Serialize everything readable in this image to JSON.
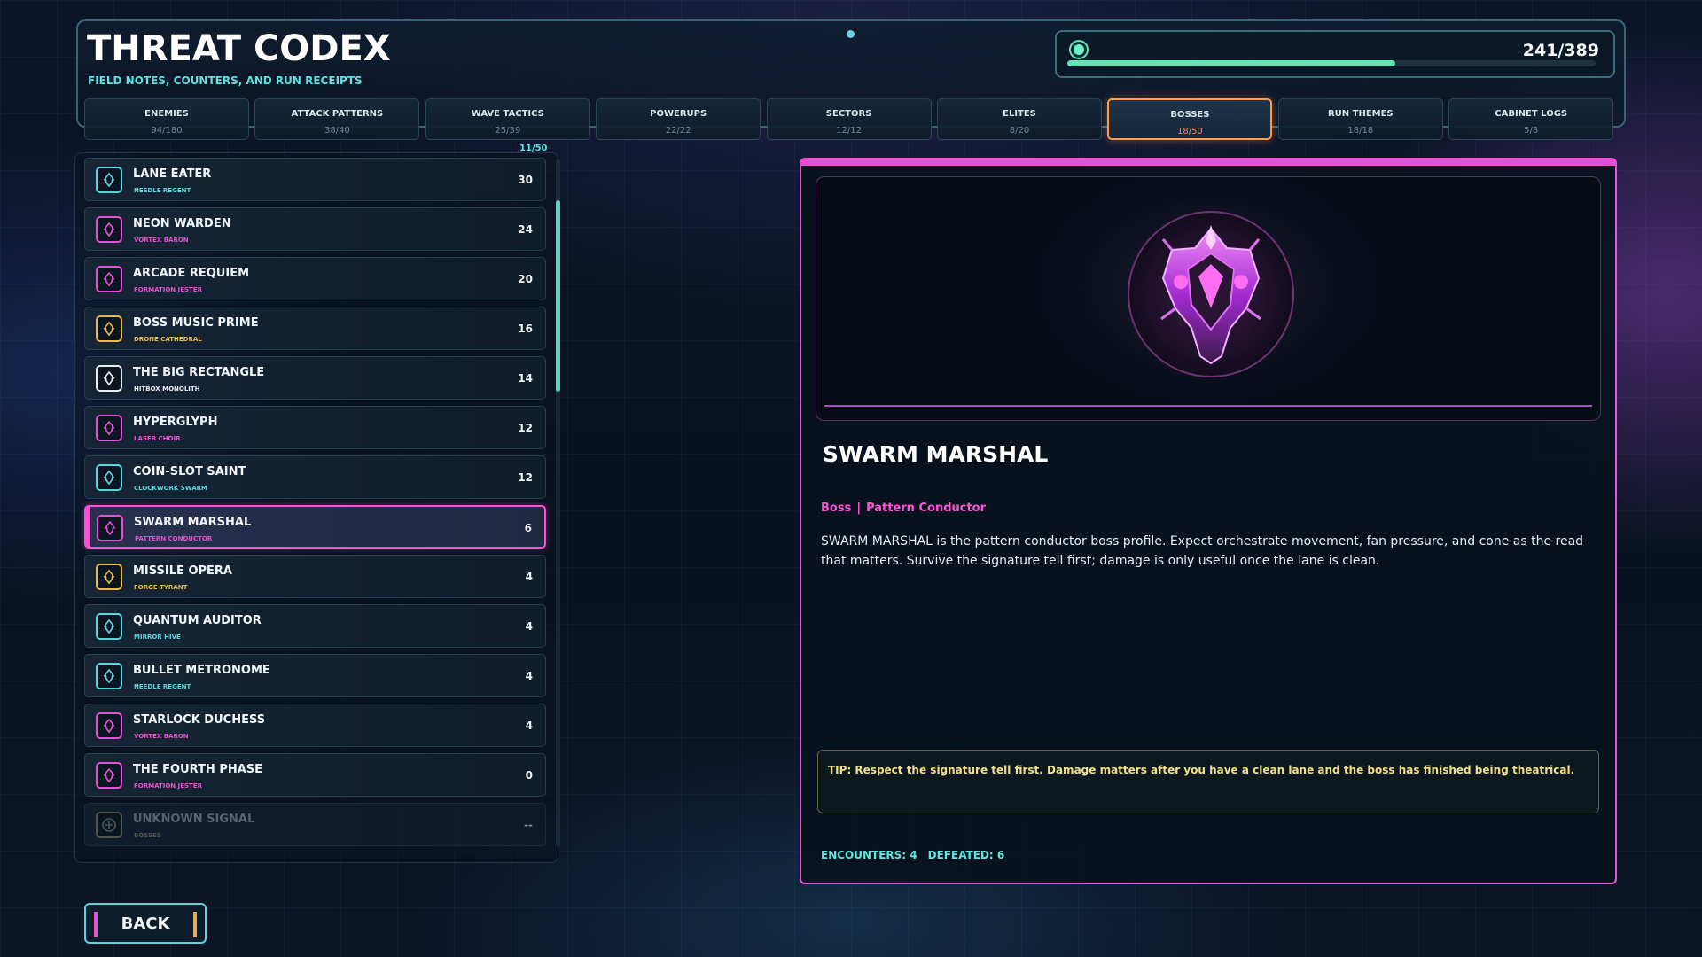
{
  "header": {
    "title": "THREAT CODEX",
    "subtitle": "FIELD NOTES, COUNTERS, AND RUN RECEIPTS",
    "progress": {
      "label": "241/389",
      "fraction": 0.62
    }
  },
  "tabs": [
    {
      "label": "ENEMIES",
      "count": "94/180"
    },
    {
      "label": "ATTACK PATTERNS",
      "count": "38/40"
    },
    {
      "label": "WAVE TACTICS",
      "count": "25/39"
    },
    {
      "label": "POWERUPS",
      "count": "22/22"
    },
    {
      "label": "SECTORS",
      "count": "12/12"
    },
    {
      "label": "ELITES",
      "count": "8/20"
    },
    {
      "label": "BOSSES",
      "count": "18/50",
      "active": true
    },
    {
      "label": "RUN THEMES",
      "count": "18/18"
    },
    {
      "label": "CABINET LOGS",
      "count": "5/8"
    }
  ],
  "list": {
    "count_label": "11/50",
    "items": [
      {
        "name": "LANE EATER",
        "sub": "NEEDLE REGENT",
        "count": "30",
        "accent": "#5cd4e0",
        "icon": "boss-sprite-icon"
      },
      {
        "name": "NEON WARDEN",
        "sub": "VORTEX BARON",
        "count": "24",
        "accent": "#e84fd4",
        "icon": "boss-sprite-icon"
      },
      {
        "name": "ARCADE REQUIEM",
        "sub": "FORMATION JESTER",
        "count": "20",
        "accent": "#e84fd4",
        "icon": "boss-sprite-icon"
      },
      {
        "name": "BOSS MUSIC PRIME",
        "sub": "DRONE CATHEDRAL",
        "count": "16",
        "accent": "#e8b84a",
        "icon": "boss-sprite-icon"
      },
      {
        "name": "THE BIG RECTANGLE",
        "sub": "HITBOX MONOLITH",
        "count": "14",
        "accent": "#e6eef2",
        "icon": "boss-sprite-icon"
      },
      {
        "name": "HYPERGLYPH",
        "sub": "LASER CHOIR",
        "count": "12",
        "accent": "#e84fd4",
        "icon": "boss-sprite-icon"
      },
      {
        "name": "COIN-SLOT SAINT",
        "sub": "CLOCKWORK SWARM",
        "count": "12",
        "accent": "#5cd4e0",
        "icon": "boss-sprite-icon"
      },
      {
        "name": "SWARM MARSHAL",
        "sub": "PATTERN CONDUCTOR",
        "count": "6",
        "accent": "#e84fd4",
        "icon": "boss-sprite-icon",
        "selected": true
      },
      {
        "name": "MISSILE OPERA",
        "sub": "FORGE TYRANT",
        "count": "4",
        "accent": "#e8b84a",
        "icon": "boss-sprite-icon"
      },
      {
        "name": "QUANTUM AUDITOR",
        "sub": "MIRROR HIVE",
        "count": "4",
        "accent": "#5cd4e0",
        "icon": "boss-sprite-icon"
      },
      {
        "name": "BULLET METRONOME",
        "sub": "NEEDLE REGENT",
        "count": "4",
        "accent": "#5cd4e0",
        "icon": "boss-sprite-icon"
      },
      {
        "name": "STARLOCK DUCHESS",
        "sub": "VORTEX BARON",
        "count": "4",
        "accent": "#e84fd4",
        "icon": "boss-sprite-icon"
      },
      {
        "name": "THE FOURTH PHASE",
        "sub": "FORMATION JESTER",
        "count": "0",
        "accent": "#e84fd4",
        "icon": "boss-sprite-icon"
      },
      {
        "name": "UNKNOWN SIGNAL",
        "sub": "BOSSES",
        "count": "--",
        "accent": "#8a8a70",
        "icon": "locked-sigil-icon",
        "locked": true
      }
    ]
  },
  "detail": {
    "name": "SWARM MARSHAL",
    "tag_type": "Boss",
    "tag_separator": "|",
    "tag_role": "Pattern Conductor",
    "description": "SWARM MARSHAL is the pattern conductor boss profile. Expect orchestrate movement, fan pressure, and cone as the read that matters. Survive the signature tell first; damage is only useful once the lane is clean.",
    "tip": "TIP: Respect the signature tell first. Damage matters after you have a clean lane and the boss has finished being theatrical.",
    "encounters_label": "ENCOUNTERS: 4",
    "defeated_label": "DEFEATED: 6"
  },
  "back_button": {
    "label": "BACK"
  },
  "colors": {
    "accent_cyan": "#5cd4e0",
    "accent_magenta": "#e84fd4",
    "accent_orange": "#ff9a4a",
    "tip_yellow": "#f2e184",
    "progress_green": "#62e4b4"
  }
}
